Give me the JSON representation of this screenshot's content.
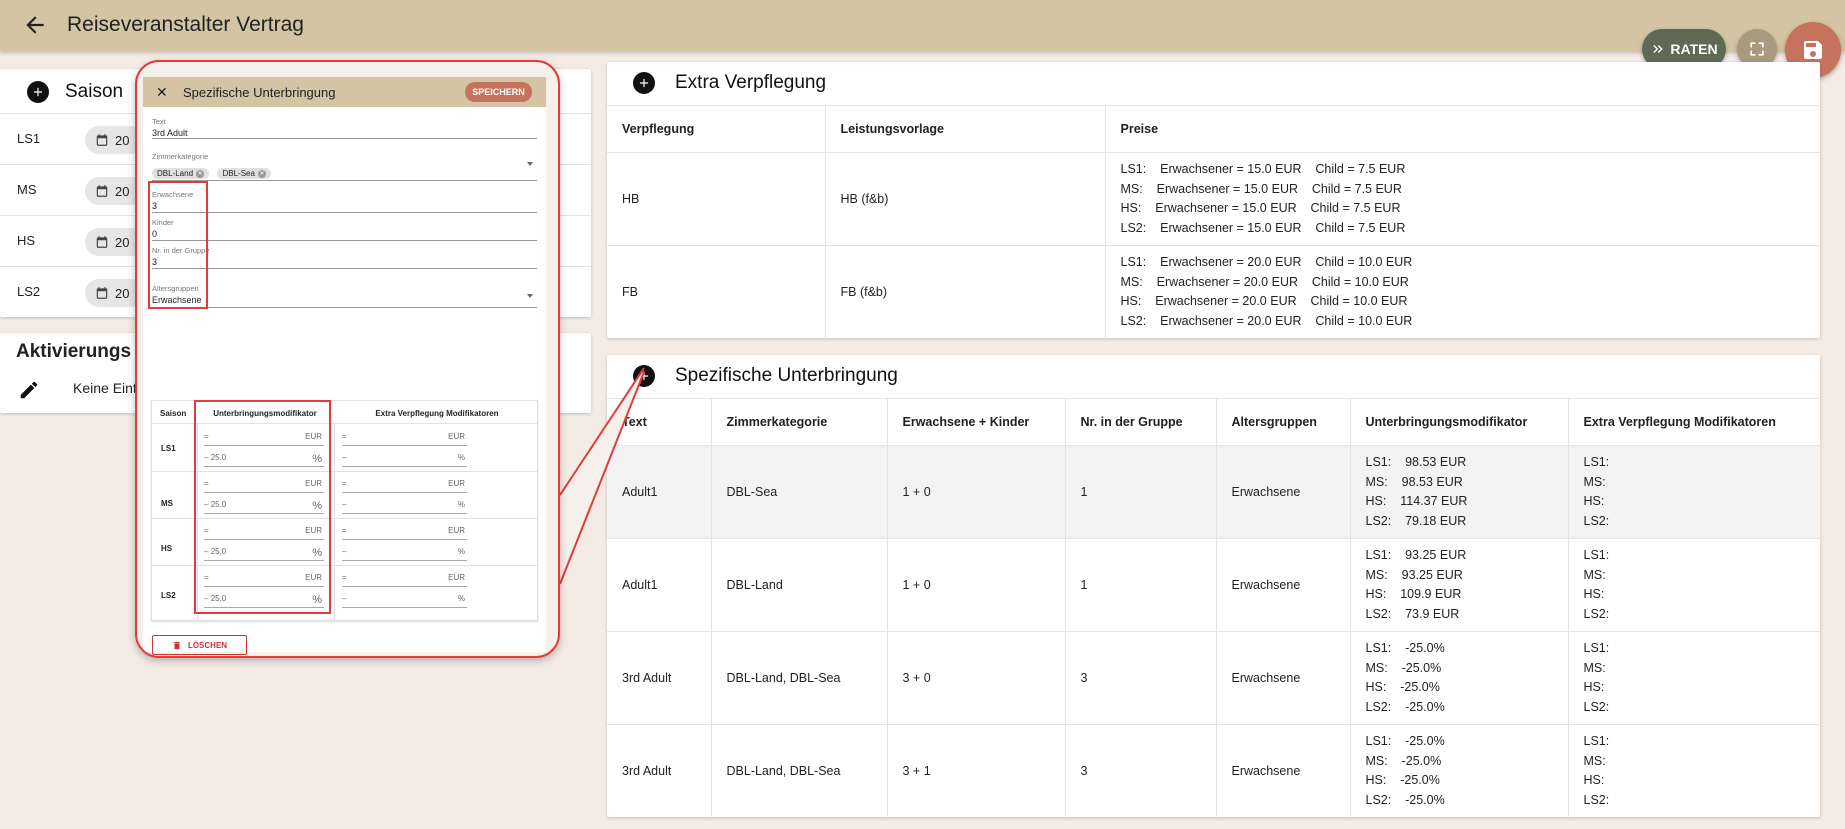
{
  "header": {
    "title": "Reiseveranstalter Vertrag"
  },
  "actions": {
    "raten_label": "RATEN"
  },
  "saison": {
    "title": "Saison",
    "rows": [
      {
        "label": "LS1",
        "date": "20"
      },
      {
        "label": "MS",
        "date": "20"
      },
      {
        "label": "HS",
        "date": "20"
      },
      {
        "label": "LS2",
        "date": "20"
      }
    ]
  },
  "aktivierung": {
    "title": "Aktivierungs",
    "text": "Keine Eint"
  },
  "extra_verpflegung": {
    "title": "Extra Verpflegung",
    "columns": [
      "Verpflegung",
      "Leistungsvorlage",
      "Preise"
    ],
    "rows": [
      {
        "verpflegung": "HB",
        "vorlage": "HB (f&b)",
        "preise": [
          "LS1:    Erwachsener = 15.0 EUR    Child = 7.5 EUR",
          "MS:    Erwachsener = 15.0 EUR    Child = 7.5 EUR",
          "HS:    Erwachsener = 15.0 EUR    Child = 7.5 EUR",
          "LS2:    Erwachsener = 15.0 EUR    Child = 7.5 EUR"
        ]
      },
      {
        "verpflegung": "FB",
        "vorlage": "FB (f&b)",
        "preise": [
          "LS1:    Erwachsener = 20.0 EUR    Child = 10.0 EUR",
          "MS:    Erwachsener = 20.0 EUR    Child = 10.0 EUR",
          "HS:    Erwachsener = 20.0 EUR    Child = 10.0 EUR",
          "LS2:    Erwachsener = 20.0 EUR    Child = 10.0 EUR"
        ]
      }
    ]
  },
  "spezifische_unterbringung": {
    "title": "Spezifische Unterbringung",
    "columns": [
      "Text",
      "Zimmerkategorie",
      "Erwachsene + Kinder",
      "Nr. in der Gruppe",
      "Altersgruppen",
      "Unterbringungsmodifikator",
      "Extra Verpflegung Modifikatoren"
    ],
    "rows": [
      {
        "text": "Adult1",
        "zimmer": "DBL-Sea",
        "ek": "1 + 0",
        "nr": "1",
        "alter": "Erwachsene",
        "mod": [
          "LS1:    98.53 EUR",
          "MS:    98.53 EUR",
          "HS:    114.37 EUR",
          "LS2:    79.18 EUR"
        ],
        "extra": [
          "LS1:",
          "MS:",
          "HS:",
          "LS2:"
        ]
      },
      {
        "text": "Adult1",
        "zimmer": "DBL-Land",
        "ek": "1 + 0",
        "nr": "1",
        "alter": "Erwachsene",
        "mod": [
          "LS1:    93.25 EUR",
          "MS:    93.25 EUR",
          "HS:    109.9 EUR",
          "LS2:    73.9 EUR"
        ],
        "extra": [
          "LS1:",
          "MS:",
          "HS:",
          "LS2:"
        ]
      },
      {
        "text": "3rd Adult",
        "zimmer": "DBL-Land, DBL-Sea",
        "ek": "3 + 0",
        "nr": "3",
        "alter": "Erwachsene",
        "mod": [
          "LS1:    -25.0%",
          "MS:    -25.0%",
          "HS:    -25.0%",
          "LS2:    -25.0%"
        ],
        "extra": [
          "LS1:",
          "MS:",
          "HS:",
          "LS2:"
        ]
      },
      {
        "text": "3rd Adult",
        "zimmer": "DBL-Land, DBL-Sea",
        "ek": "3 + 1",
        "nr": "3",
        "alter": "Erwachsene",
        "mod": [
          "LS1:    -25.0%",
          "MS:    -25.0%",
          "HS:    -25.0%",
          "LS2:    -25.0%"
        ],
        "extra": [
          "LS1:",
          "MS:",
          "HS:",
          "LS2:"
        ]
      }
    ]
  },
  "dialog": {
    "title": "Spezifische Unterbringung",
    "save_label": "SPEICHERN",
    "text_label": "Text",
    "text_value": "3rd Adult",
    "zimmer_label": "Zimmerkategorie",
    "zimmer_chips": [
      "DBL-Land",
      "DBL-Sea"
    ],
    "erwachsene_label": "Erwachsene",
    "erwachsene_value": "3",
    "kinder_label": "Kinder",
    "kinder_value": "0",
    "nr_label": "Nr. in der Gruppe",
    "nr_value": "3",
    "alter_label": "Altersgruppen",
    "alter_value": "Erwachsene",
    "table_cols": [
      "Saison",
      "Unterbringungsmodifikator",
      "Extra Verpflegung Modifikatoren"
    ],
    "table_rows": [
      {
        "saison": "LS1",
        "mod_value": "25.0"
      },
      {
        "saison": "MS",
        "mod_value": "25.0"
      },
      {
        "saison": "HS",
        "mod_value": "25.0"
      },
      {
        "saison": "LS2",
        "mod_value": "25.0"
      }
    ],
    "eq_sign": "=",
    "eur": "EUR",
    "minus": "–",
    "pct": "%",
    "delete_label": "LÖSCHEN"
  }
}
